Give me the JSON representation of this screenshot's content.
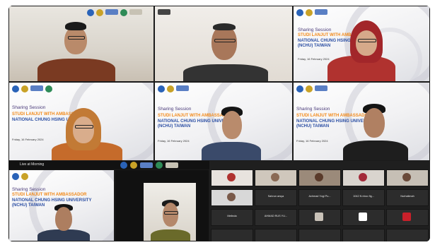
{
  "slide": {
    "kicker": "Sharing Session",
    "title_line1": "STUDI LANJUT WITH AMBASSADOR",
    "title_line2": "NATIONAL CHUNG HSING UNIVERSITY",
    "title_line3": "(NCHU) TAIWAN",
    "date": "Friday, 16 February 2024"
  },
  "strip": {
    "label": "Live at Morning"
  },
  "gallery": {
    "row1": [
      "",
      "",
      "",
      "",
      ""
    ],
    "row2": [
      "",
      "Sahrun arsya",
      "Achmad Yogi Pu...",
      "1042 N nbco fig...",
      "Nurhalimah"
    ],
    "row3": [
      "Melinda",
      "AHMAD RUS YU...",
      "",
      "",
      ""
    ]
  },
  "colors": {
    "accent_orange": "#f28a1a",
    "accent_blue": "#2b4ea3",
    "dark": "#1b1b1b"
  }
}
